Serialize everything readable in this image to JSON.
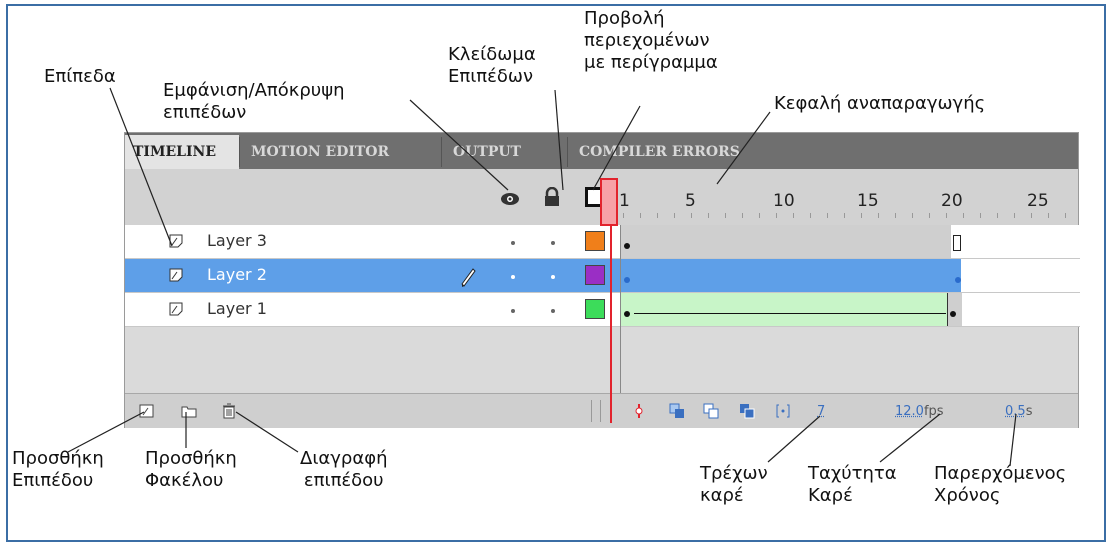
{
  "annotations": {
    "layers": "Επίπεδα",
    "show_hide": [
      "Εμφάνιση/Απόκρυψη",
      "επιπέδων"
    ],
    "lock": [
      "Κλείδωμα",
      "Επιπέδων"
    ],
    "outline": [
      "Προβολή",
      "περιεχομένων",
      "με περίγραμμα"
    ],
    "playhead": "Κεφαλή αναπαραγωγής",
    "add_layer": [
      "Προσθήκη",
      "Επιπέδου"
    ],
    "add_folder": [
      "Προσθήκη",
      "Φακέλου"
    ],
    "delete_layer": [
      "Διαγραφή",
      "επιπέδου"
    ],
    "current_frame": [
      "Τρέχων",
      "καρέ"
    ],
    "frame_rate": [
      "Ταχύτητα",
      "Καρέ"
    ],
    "elapsed_time": [
      "Παρερχόμενος",
      "Χρόνος"
    ]
  },
  "tabs": [
    "TIMELINE",
    "MOTION EDITOR",
    "OUTPUT",
    "COMPILER ERRORS"
  ],
  "ruler": [
    "1",
    "5",
    "10",
    "15",
    "20",
    "25"
  ],
  "layers": [
    {
      "name": "Layer 3",
      "color": "#f07f1a",
      "selected": false
    },
    {
      "name": "Layer 2",
      "color": "#9a2ec5",
      "selected": true
    },
    {
      "name": "Layer 1",
      "color": "#3cdc5a",
      "selected": false
    }
  ],
  "footer": {
    "current_frame": "7",
    "fps": "12.0",
    "fps_unit": "fps",
    "elapsed": "0.5",
    "elapsed_unit": "s"
  },
  "colors": {
    "selected_row": "#5e9fe8",
    "tween_fill": "#c8f5c8",
    "playhead": "#e2232d",
    "frame_border": "#3b6ea5"
  }
}
